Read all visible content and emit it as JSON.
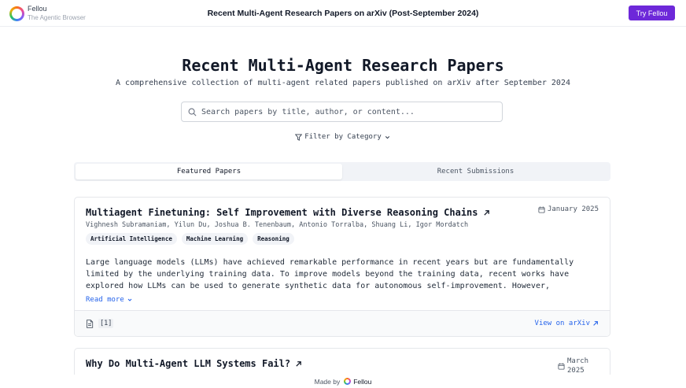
{
  "header": {
    "brand_name": "Fellou",
    "brand_tagline": "The Agentic Browser",
    "title": "Recent Multi-Agent Research Papers on arXiv (Post-September 2024)",
    "cta_label": "Try Fellou",
    "cta_color": "#6d28d9"
  },
  "hero": {
    "title": "Recent Multi-Agent Research Papers",
    "subtitle": "A comprehensive collection of multi-agent related papers published on arXiv after September 2024"
  },
  "search": {
    "placeholder": "Search papers by title, author, or content...",
    "value": "",
    "icon": "search-icon"
  },
  "filter": {
    "label": "Filter by Category"
  },
  "tabs": [
    {
      "label": "Featured Papers",
      "active": true
    },
    {
      "label": "Recent Submissions",
      "active": false
    }
  ],
  "papers": [
    {
      "title": "Multiagent Finetuning: Self Improvement with Diverse Reasoning Chains",
      "date": "January 2025",
      "authors": "Vighnesh Subramaniam, Yilun Du, Joshua B. Tenenbaum, Antonio Torralba, Shuang Li, Igor Mordatch",
      "tags": [
        "Artificial Intelligence",
        "Machine Learning",
        "Reasoning"
      ],
      "abstract": "Large language models (LLMs) have achieved remarkable performance in recent years but are fundamentally limited by the underlying training data. To improve models beyond the training data, recent works have explored how LLMs can be used to generate synthetic data for autonomous self-improvement. However, successive steps of self-improvement can reach a point of diminishing returns.",
      "read_more_label": "Read more",
      "references": "[1]",
      "link_label": "View on arXiv"
    },
    {
      "title": "Why Do Multi-Agent LLM Systems Fail?",
      "date": "March 2025"
    }
  ],
  "footer": {
    "made_by_label": "Made by",
    "brand_name": "Fellou"
  },
  "colors": {
    "accent": "#6d28d9",
    "link": "#2563eb"
  }
}
